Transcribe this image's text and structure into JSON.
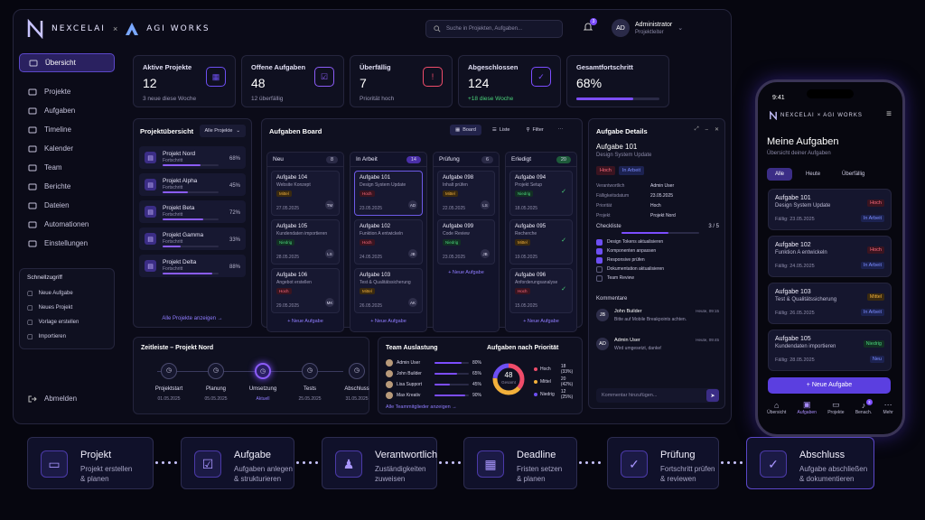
{
  "brand": {
    "name": "NEXCELAI",
    "x": "×",
    "partner": "AGI WORKS"
  },
  "search": {
    "placeholder": "Suche in Projekten, Aufgaben..."
  },
  "notifications": {
    "count": "3"
  },
  "user": {
    "initials": "AD",
    "name": "Administrator",
    "role": "Projektleiter"
  },
  "sidebar": {
    "items": [
      {
        "label": "Übersicht",
        "icon": "home-icon"
      },
      {
        "label": "Projekte",
        "icon": "folder-icon"
      },
      {
        "label": "Aufgaben",
        "icon": "folder-icon"
      },
      {
        "label": "Timeline",
        "icon": "timeline-icon"
      },
      {
        "label": "Kalender",
        "icon": "calendar-icon"
      },
      {
        "label": "Team",
        "icon": "team-icon"
      },
      {
        "label": "Berichte",
        "icon": "chart-icon"
      },
      {
        "label": "Dateien",
        "icon": "file-icon"
      },
      {
        "label": "Automationen",
        "icon": "bolt-icon"
      },
      {
        "label": "Einstellungen",
        "icon": "gear-icon"
      }
    ],
    "quick_title": "Schnellzugriff",
    "quick": [
      "Neue Aufgabe",
      "Neues Projekt",
      "Vorlage erstellen",
      "Importieren"
    ],
    "logout": "Abmelden"
  },
  "kpis": [
    {
      "title": "Aktive Projekte",
      "value": "12",
      "sub": "3 neue diese Woche"
    },
    {
      "title": "Offene Aufgaben",
      "value": "48",
      "sub": "12 überfällig"
    },
    {
      "title": "Überfällig",
      "value": "7",
      "sub": "Priorität hoch"
    },
    {
      "title": "Abgeschlossen",
      "value": "124",
      "sub": "+18 diese Woche"
    },
    {
      "title": "Gesamtfortschritt",
      "value": "68%",
      "progress": 0.68
    }
  ],
  "projects": {
    "title": "Projektübersicht",
    "filter": "Alle Projekte",
    "items": [
      {
        "name": "Projekt Nord",
        "status": "Fortschritt",
        "pct": "68%",
        "progress": 0.68
      },
      {
        "name": "Projekt Alpha",
        "status": "Fortschritt",
        "pct": "45%",
        "progress": 0.45
      },
      {
        "name": "Projekt Beta",
        "status": "Fortschritt",
        "pct": "72%",
        "progress": 0.72
      },
      {
        "name": "Projekt Gamma",
        "status": "Fortschritt",
        "pct": "33%",
        "progress": 0.33
      },
      {
        "name": "Projekt Delta",
        "status": "Fortschritt",
        "pct": "88%",
        "progress": 0.88
      }
    ],
    "show_all": "Alle Projekte anzeigen →"
  },
  "board": {
    "title": "Aufgaben Board",
    "view_board": "Board",
    "view_list": "Liste",
    "filter": "Filter",
    "columns": [
      {
        "name": "Neu",
        "count": "8",
        "cards": [
          {
            "title": "Aufgabe 104",
            "sub": "Website Konzept",
            "tag": "Mittel",
            "tagc": "amber",
            "date": "27.05.2025",
            "av": "TM"
          },
          {
            "title": "Aufgabe 105",
            "sub": "Kundendaten importieren",
            "tag": "Niedrig",
            "tagc": "green",
            "date": "28.05.2025",
            "av": "LS"
          },
          {
            "title": "Aufgabe 106",
            "sub": "Angebot erstellen",
            "tag": "Hoch",
            "tagc": "red",
            "date": "29.05.2025",
            "av": "MK"
          }
        ],
        "add": "+ Neue Aufgabe"
      },
      {
        "name": "In Arbeit",
        "count": "14",
        "cards": [
          {
            "title": "Aufgabe 101",
            "sub": "Design System Update",
            "tag": "Hoch",
            "tagc": "red",
            "date": "23.05.2025",
            "av": "AD"
          },
          {
            "title": "Aufgabe 102",
            "sub": "Funktion A entwickeln",
            "tag": "Hoch",
            "tagc": "red",
            "date": "24.05.2025",
            "av": "JB"
          },
          {
            "title": "Aufgabe 103",
            "sub": "Test & Qualitätssicherung",
            "tag": "Mittel",
            "tagc": "amber",
            "date": "26.05.2025",
            "av": "AK"
          }
        ],
        "add": "+ Neue Aufgabe"
      },
      {
        "name": "Prüfung",
        "count": "6",
        "cards": [
          {
            "title": "Aufgabe 098",
            "sub": "Inhalt prüfen",
            "tag": "Mittel",
            "tagc": "amber",
            "date": "22.05.2025",
            "av": "LS"
          },
          {
            "title": "Aufgabe 099",
            "sub": "Code Review",
            "tag": "Niedrig",
            "tagc": "green",
            "date": "23.05.2025",
            "av": "JB"
          }
        ],
        "add": "+ Neue Aufgabe"
      },
      {
        "name": "Erledigt",
        "count": "20",
        "cards": [
          {
            "title": "Aufgabe 094",
            "sub": "Projekt Setup",
            "tag": "Niedrig",
            "tagc": "green",
            "date": "18.05.2025"
          },
          {
            "title": "Aufgabe 095",
            "sub": "Recherche",
            "tag": "Mittel",
            "tagc": "amber",
            "date": "19.05.2025"
          },
          {
            "title": "Aufgabe 096",
            "sub": "Anforderungsanalyse",
            "tag": "Hoch",
            "tagc": "red",
            "date": "15.05.2025"
          }
        ],
        "add": "+ Neue Aufgabe"
      }
    ]
  },
  "details": {
    "title": "Aufgabe Details",
    "task": "Aufgabe 101",
    "sub": "Design System Update",
    "tags": [
      "Hoch",
      "In Arbeit"
    ],
    "rows": [
      {
        "k": "Verantwortlich",
        "v": "Admin User"
      },
      {
        "k": "Fälligkeitsdatum",
        "v": "23.05.2025"
      },
      {
        "k": "Priorität",
        "v": "Hoch"
      },
      {
        "k": "Projekt",
        "v": "Projekt Nord"
      }
    ],
    "checklist_title": "Checkliste",
    "checklist_count": "3 / 5",
    "checklist_progress": 0.6,
    "checklist": [
      {
        "t": "Design Tokens aktualisieren",
        "done": true
      },
      {
        "t": "Komponenten anpassen",
        "done": true
      },
      {
        "t": "Responsive prüfen",
        "done": true
      },
      {
        "t": "Dokumentation aktualisieren",
        "done": false
      },
      {
        "t": "Team Review",
        "done": false
      }
    ],
    "comments_title": "Kommentare",
    "comments": [
      {
        "av": "JB",
        "name": "John Builder",
        "time": "Heute, 09:15",
        "text": "Bitte auf Mobile Breakpoints achten."
      },
      {
        "av": "AD",
        "name": "Admin User",
        "time": "Heute, 09:45",
        "text": "Wird umgesetzt, danke!"
      }
    ],
    "comment_placeholder": "Kommentar hinzufügen..."
  },
  "timeline": {
    "title": "Zeitleiste – Projekt Nord",
    "steps": [
      {
        "label": "Projektstart",
        "date": "01.05.2025"
      },
      {
        "label": "Planung",
        "date": "05.05.2025"
      },
      {
        "label": "Umsetzung",
        "date": "Aktuell"
      },
      {
        "label": "Tests",
        "date": "25.05.2025"
      },
      {
        "label": "Abschluss",
        "date": "31.05.2025"
      }
    ]
  },
  "team": {
    "title": "Team Auslastung",
    "members": [
      {
        "name": "Admin User",
        "pct": "80%",
        "load": 0.8
      },
      {
        "name": "John Builder",
        "pct": "65%",
        "load": 0.65
      },
      {
        "name": "Lisa Support",
        "pct": "45%",
        "load": 0.45
      },
      {
        "name": "Max Kreativ",
        "pct": "90%",
        "load": 0.9
      }
    ],
    "show_all": "Alle Teammitglieder anzeigen →"
  },
  "priority": {
    "title": "Aufgaben nach Priorität",
    "total": "48",
    "total_label": "Gesamt",
    "items": [
      {
        "name": "Hoch",
        "value": "18 (33%)",
        "color": "#ef4c6a",
        "n": 18
      },
      {
        "name": "Mittel",
        "value": "20 (42%)",
        "color": "#f2b03b",
        "n": 20
      },
      {
        "name": "Niedrig",
        "value": "12 (25%)",
        "color": "#6d4ff2",
        "n": 12
      }
    ]
  },
  "phone": {
    "time": "9:41",
    "title": "Meine Aufgaben",
    "sub": "Übersicht deiner Aufgaben",
    "tabs": [
      "Alle",
      "Heute",
      "Überfällig"
    ],
    "tasks": [
      {
        "title": "Aufgabe 101",
        "sub": "Design System Update",
        "date": "Fällig: 23.05.2025",
        "tag1": "Hoch",
        "tag1c": "red",
        "tag2": "In Arbeit"
      },
      {
        "title": "Aufgabe 102",
        "sub": "Funktion A entwickeln",
        "date": "Fällig: 24.05.2025",
        "tag1": "Hoch",
        "tag1c": "red",
        "tag2": "In Arbeit"
      },
      {
        "title": "Aufgabe 103",
        "sub": "Test & Qualitätssicherung",
        "date": "Fällig: 26.05.2025",
        "tag1": "Mittel",
        "tag1c": "amber",
        "tag2": "In Arbeit"
      },
      {
        "title": "Aufgabe 105",
        "sub": "Kundendaten importieren",
        "date": "Fällig: 28.05.2025",
        "tag1": "Niedrig",
        "tag1c": "green",
        "tag2": "Neu"
      }
    ],
    "new_button": "+ Neue Aufgabe",
    "nav": [
      "Übersicht",
      "Aufgaben",
      "Projekte",
      "Benach.",
      "Mehr"
    ],
    "nav_badge": "3"
  },
  "flow": [
    {
      "title": "Projekt",
      "sub1": "Projekt erstellen",
      "sub2": "& planen"
    },
    {
      "title": "Aufgabe",
      "sub1": "Aufgaben anlegen",
      "sub2": "& strukturieren"
    },
    {
      "title": "Verantwortlich",
      "sub1": "Zuständigkeiten",
      "sub2": "zuweisen"
    },
    {
      "title": "Deadline",
      "sub1": "Fristen setzen",
      "sub2": "& planen"
    },
    {
      "title": "Prüfung",
      "sub1": "Fortschritt prüfen",
      "sub2": "& reviewen"
    },
    {
      "title": "Abschluss",
      "sub1": "Aufgabe abschließen",
      "sub2": "& dokumentieren"
    }
  ],
  "colors": {
    "accent": "#6d4ff2",
    "bg": "#0b0b18",
    "high": "#ef4c6a",
    "mid": "#f2b03b",
    "low": "#4ad27a"
  }
}
